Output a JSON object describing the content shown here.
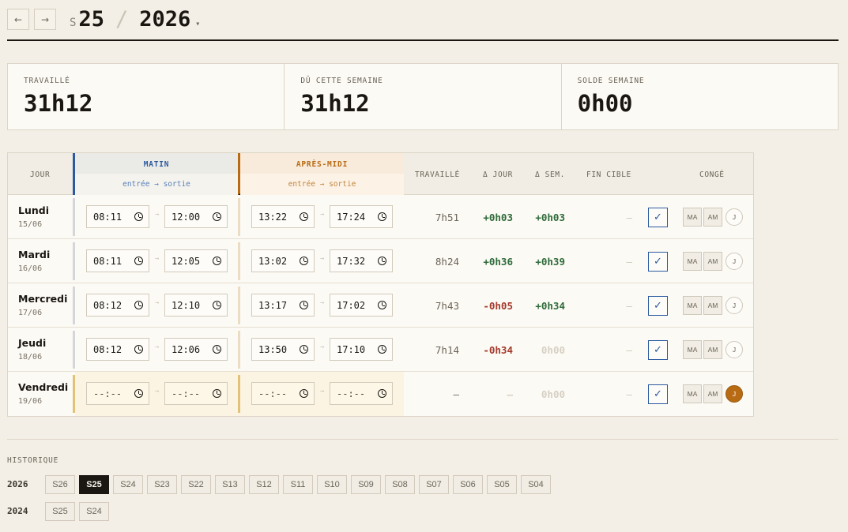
{
  "header": {
    "prev": "←",
    "next": "→",
    "week_prefix": "S",
    "week": "25",
    "sep": "/",
    "year": "2026",
    "caret": "▾"
  },
  "stats": [
    {
      "label": "TRAVAILLÉ",
      "value": "31h12"
    },
    {
      "label": "DÛ CETTE SEMAINE",
      "value": "31h12"
    },
    {
      "label": "SOLDE SEMAINE",
      "value": "0h00"
    }
  ],
  "table": {
    "headers": {
      "jour": "JOUR",
      "matin": "MATIN",
      "matin_sub": "entrée → sortie",
      "apres": "APRÈS-MIDI",
      "apres_sub": "entrée → sortie",
      "travaille": "TRAVAILLÉ",
      "delta_jour": "Δ JOUR",
      "delta_sem": "Δ SEM.",
      "fin_cible": "FIN CIBLE",
      "conge": "CONGÉ"
    },
    "arrow": "→",
    "rows": [
      {
        "day": "Lundi",
        "date": "15/06",
        "m_in": "08:11",
        "m_out": "12:00",
        "a_in": "13:22",
        "a_out": "17:24",
        "worked": "7h51",
        "dj": "+0h03",
        "ds": "+0h03",
        "fin": "—",
        "check": "✓",
        "ma": "MA",
        "am": "AM",
        "j": "J"
      },
      {
        "day": "Mardi",
        "date": "16/06",
        "m_in": "08:11",
        "m_out": "12:05",
        "a_in": "13:02",
        "a_out": "17:32",
        "worked": "8h24",
        "dj": "+0h36",
        "ds": "+0h39",
        "fin": "—",
        "check": "✓",
        "ma": "MA",
        "am": "AM",
        "j": "J"
      },
      {
        "day": "Mercredi",
        "date": "17/06",
        "m_in": "08:12",
        "m_out": "12:10",
        "a_in": "13:17",
        "a_out": "17:02",
        "worked": "7h43",
        "dj": "-0h05",
        "ds": "+0h34",
        "fin": "—",
        "check": "✓",
        "ma": "MA",
        "am": "AM",
        "j": "J"
      },
      {
        "day": "Jeudi",
        "date": "18/06",
        "m_in": "08:12",
        "m_out": "12:06",
        "a_in": "13:50",
        "a_out": "17:10",
        "worked": "7h14",
        "dj": "-0h34",
        "ds": "0h00",
        "fin": "—",
        "check": "✓",
        "ma": "MA",
        "am": "AM",
        "j": "J"
      },
      {
        "day": "Vendredi",
        "date": "19/06",
        "m_in": "--:--",
        "m_out": "--:--",
        "a_in": "--:--",
        "a_out": "--:--",
        "worked": "—",
        "dj": "—",
        "ds": "0h00",
        "fin": "—",
        "check": "✓",
        "ma": "MA",
        "am": "AM",
        "j": "J"
      }
    ]
  },
  "history": {
    "label": "HISTORIQUE",
    "years": [
      {
        "year": "2026",
        "weeks": [
          "S26",
          "S25",
          "S24",
          "S23",
          "S22",
          "S13",
          "S12",
          "S11",
          "S10",
          "S09",
          "S08",
          "S07",
          "S06",
          "S05",
          "S04"
        ]
      },
      {
        "year": "2024",
        "weeks": [
          "S25",
          "S24"
        ]
      }
    ]
  }
}
